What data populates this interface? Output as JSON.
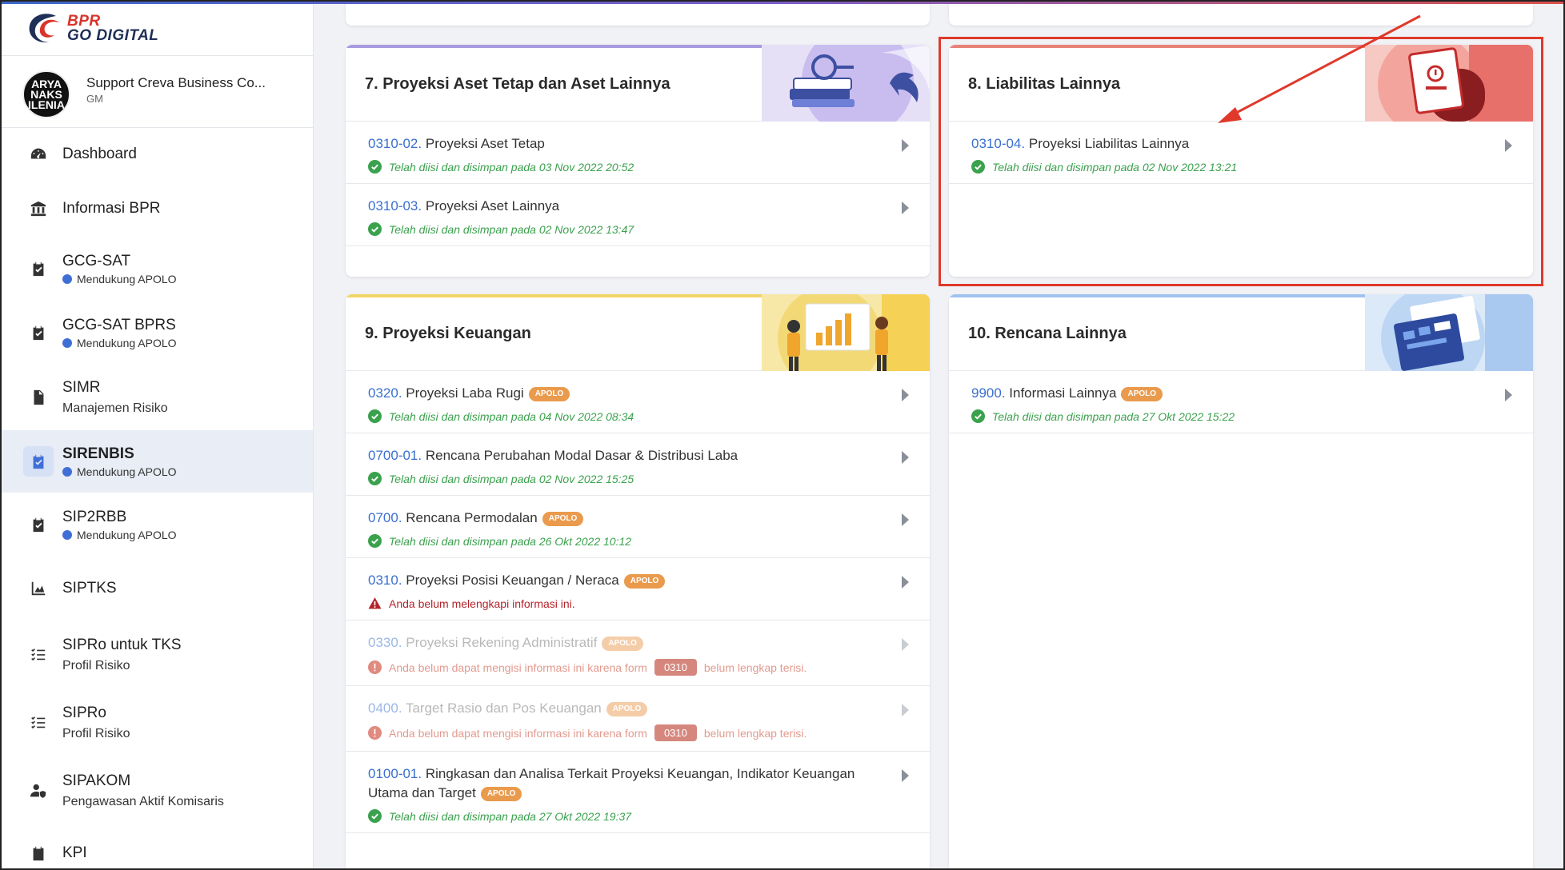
{
  "logo": {
    "line1": "BPR",
    "line2": "GO DIGITAL"
  },
  "profile": {
    "avatar_text": [
      "ARYA",
      "NAKS",
      "ILENIA"
    ],
    "name": "Support Creva Business Co...",
    "role": "GM"
  },
  "sidebar": {
    "items": [
      {
        "title": "Dashboard",
        "icon": "dashboard-gauge-icon"
      },
      {
        "title": "Informasi BPR",
        "icon": "bank-building-icon"
      },
      {
        "title": "GCG-SAT",
        "badge": "Mendukung APOLO",
        "icon": "clipboard-check-icon"
      },
      {
        "title": "GCG-SAT BPRS",
        "badge": "Mendukung APOLO",
        "icon": "clipboard-check-icon"
      },
      {
        "title": "SIMR",
        "subtitle": "Manajemen Risiko",
        "icon": "document-icon"
      },
      {
        "title": "SIRENBIS",
        "badge": "Mendukung APOLO",
        "icon": "clipboard-check-icon",
        "active": true
      },
      {
        "title": "SIP2RBB",
        "badge": "Mendukung APOLO",
        "icon": "clipboard-check-icon"
      },
      {
        "title": "SIPTKS",
        "icon": "area-chart-icon"
      },
      {
        "title": "SIPRo untuk TKS",
        "subtitle": "Profil Risiko",
        "icon": "checklist-icon"
      },
      {
        "title": "SIPRo",
        "subtitle": "Profil Risiko",
        "icon": "checklist-icon"
      },
      {
        "title": "SIPAKOM",
        "subtitle": "Pengawasan Aktif Komisaris",
        "icon": "user-shield-icon"
      },
      {
        "title": "KPI",
        "icon": "clipboard-list-icon"
      }
    ]
  },
  "colors": {
    "accent_blue": "#3a6fcf",
    "success_green": "#3aa14d",
    "warning_red": "#b5232a",
    "apolo_orange": "#ea9a4c",
    "highlight_red": "#e0392b"
  },
  "cards": {
    "card7": {
      "title": "7. Proyeksi Aset Tetap dan Aset Lainnya",
      "items": [
        {
          "code": "0310-02.",
          "label": "Proyeksi Aset Tetap",
          "status": "Telah diisi dan disimpan pada 03 Nov 2022 20:52"
        },
        {
          "code": "0310-03.",
          "label": "Proyeksi Aset Lainnya",
          "status": "Telah diisi dan disimpan pada 02 Nov 2022 13:47"
        }
      ]
    },
    "card8": {
      "title": "8. Liabilitas Lainnya",
      "items": [
        {
          "code": "0310-04.",
          "label": "Proyeksi Liabilitas Lainnya",
          "status": "Telah diisi dan disimpan pada 02 Nov 2022 13:21"
        }
      ]
    },
    "card9": {
      "title": "9. Proyeksi Keuangan",
      "items": [
        {
          "code": "0320.",
          "label": "Proyeksi Laba Rugi",
          "apolo": "APOLO",
          "status": "Telah diisi dan disimpan pada 04 Nov 2022 08:34"
        },
        {
          "code": "0700-01.",
          "label": "Rencana Perubahan Modal Dasar & Distribusi Laba",
          "status": "Telah diisi dan disimpan pada 02 Nov 2022 15:25"
        },
        {
          "code": "0700.",
          "label": "Rencana Permodalan",
          "apolo": "APOLO",
          "status": "Telah diisi dan disimpan pada 26 Okt 2022 10:12"
        },
        {
          "code": "0310.",
          "label": "Proyeksi Posisi Keuangan / Neraca",
          "apolo": "APOLO",
          "warning": "Anda belum melengkapi informasi ini."
        },
        {
          "code": "0330.",
          "label": "Proyeksi Rekening Administratif",
          "apolo": "APOLO",
          "blocked_pre": "Anda belum dapat mengisi informasi ini karena form",
          "blocked_form": "0310",
          "blocked_post": "belum lengkap terisi."
        },
        {
          "code": "0400.",
          "label": "Target Rasio dan Pos Keuangan",
          "apolo": "APOLO",
          "blocked_pre": "Anda belum dapat mengisi informasi ini karena form",
          "blocked_form": "0310",
          "blocked_post": "belum lengkap terisi."
        },
        {
          "code": "0100-01.",
          "label": "Ringkasan dan Analisa Terkait Proyeksi Keuangan, Indikator Keuangan Utama dan Target",
          "apolo": "APOLO",
          "status": "Telah diisi dan disimpan pada 27 Okt 2022 19:37"
        }
      ]
    },
    "card10": {
      "title": "10. Rencana Lainnya",
      "items": [
        {
          "code": "9900.",
          "label": "Informasi Lainnya",
          "apolo": "APOLO",
          "status": "Telah diisi dan disimpan pada 27 Okt 2022 15:22"
        }
      ]
    }
  }
}
